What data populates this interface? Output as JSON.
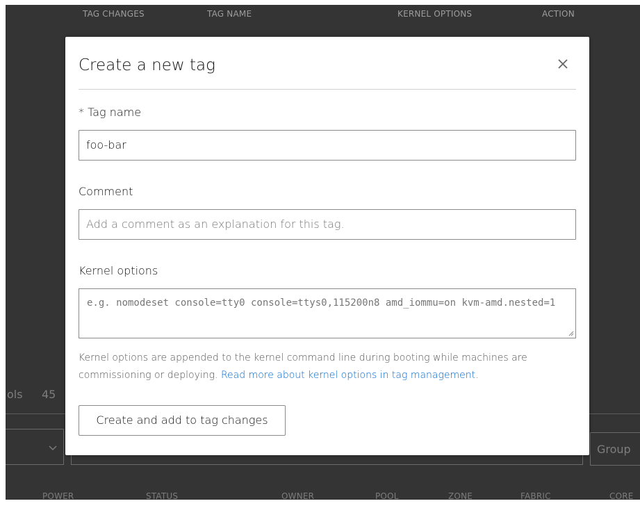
{
  "background": {
    "table_headers": [
      "TAG CHANGES",
      "TAG NAME",
      "KERNEL OPTIONS",
      "ACTION"
    ],
    "side_text_left": "ols",
    "side_count": "45",
    "group_select": "Group",
    "machine_columns": [
      "POWER",
      "STATUS",
      "OWNER",
      "POOL",
      "ZONE",
      "FABRIC",
      "CORE"
    ]
  },
  "modal": {
    "title": "Create a new tag",
    "close_icon": "close-icon",
    "tag_name": {
      "label": "* Tag name",
      "value": "foo-bar"
    },
    "comment": {
      "label": "Comment",
      "placeholder": "Add a comment as an explanation for this tag."
    },
    "kernel_options": {
      "label": "Kernel options",
      "placeholder": "e.g. nomodeset console=tty0 console=ttys0,115200n8 amd_iommu=on kvm-amd.nested=1"
    },
    "help_text": "Kernel options are appended to the kernel command line during booting while machines are commissioning or deploying.",
    "help_link": "Read more about kernel options in tag management",
    "help_end": ".",
    "submit_label": "Create and add to tag changes"
  },
  "colors": {
    "link": "#0066cc",
    "overlay": "#111111"
  }
}
